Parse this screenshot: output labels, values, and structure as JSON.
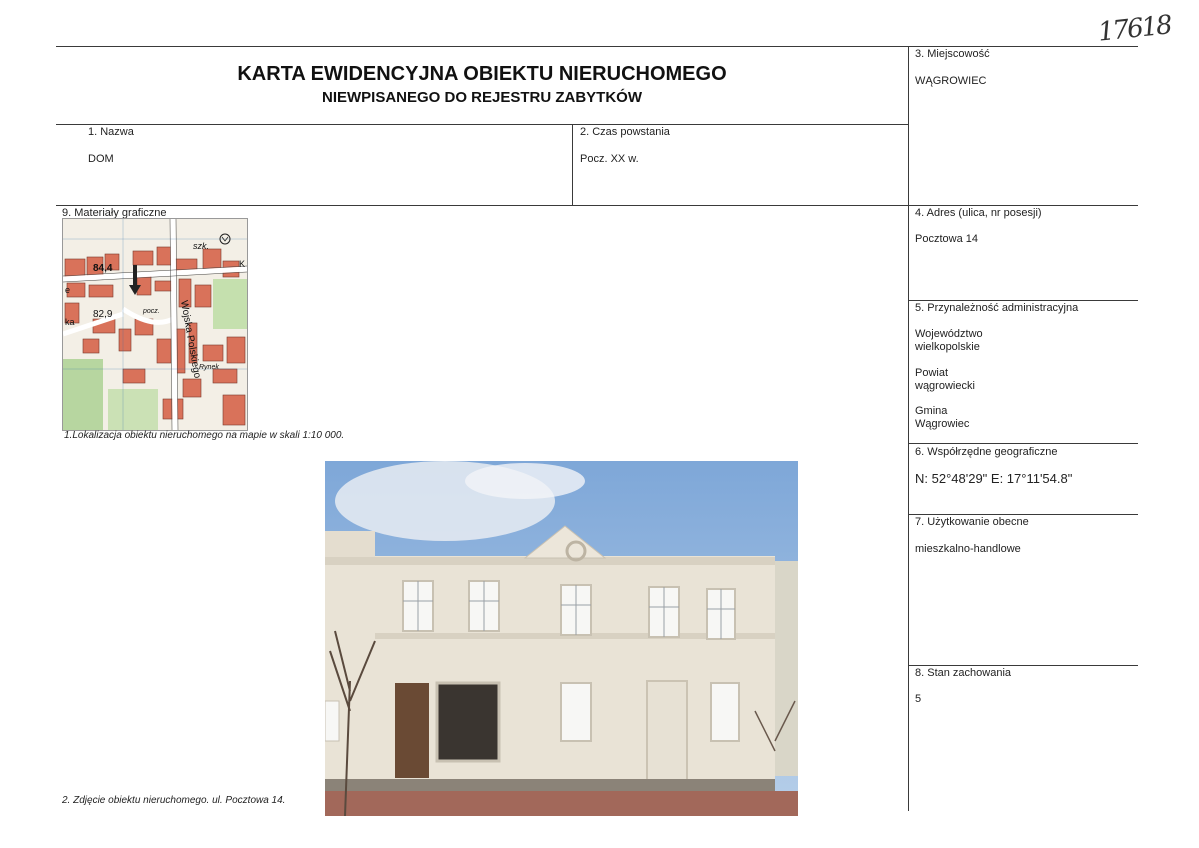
{
  "handwritten_number": "17618",
  "header": {
    "title": "KARTA EWIDENCYJNA OBIEKTU NIERUCHOMEGO",
    "subtitle": "NIEWPISANEGO DO REJESTRU ZABYTKÓW"
  },
  "fields": {
    "nazwa": {
      "label": "1.     Nazwa",
      "value": "DOM"
    },
    "czas_powstania": {
      "label": "2. Czas powstania",
      "value": "Pocz. XX w."
    },
    "miejscowosc": {
      "label": "3. Miejscowość",
      "value": "WĄGROWIEC"
    },
    "adres": {
      "label": "4. Adres (ulica, nr posesji)",
      "value": "Pocztowa 14"
    },
    "przynaleznosc": {
      "label": "5. Przynależność administracyjna",
      "wojewodztwo_label": "Województwo",
      "wojewodztwo_value": "wielkopolskie",
      "powiat_label": "Powiat",
      "powiat_value": "wągrowiecki",
      "gmina_label": "Gmina",
      "gmina_value": "Wągrowiec"
    },
    "wspolrzedne": {
      "label": "6. Współrzędne geograficzne",
      "value": "N: 52°48'29\"  E: 17°11'54.8\""
    },
    "uzytkowanie": {
      "label": "7. Użytkowanie obecne",
      "value": "mieszkalno-handlowe"
    },
    "stan": {
      "label": "8. Stan zachowania",
      "value": "5"
    },
    "materialy": {
      "label": "9. Materiały graficzne"
    }
  },
  "captions": {
    "map": "1.Lokalizacja obiektu nieruchomego na mapie w skali 1:10 000.",
    "photo": "2. Zdjęcie obiektu nieruchomego. ul. Pocztowa 14."
  },
  "map_labels": {
    "elevation_1": "84,4",
    "elevation_2": "82,9",
    "street": "Wojska Polskiego",
    "abbr_szk": "szk.",
    "abbr_pocz": "pocz.",
    "abbr_ryn": "Rynek",
    "abbr_ka": "ka",
    "abbr_k": "K",
    "abbr_e": "e"
  },
  "colors": {
    "map_buildings": "#d9725a",
    "map_green": "#a8cf8e",
    "sky": "#8fb5e0",
    "facade": "#e9e3d6"
  }
}
